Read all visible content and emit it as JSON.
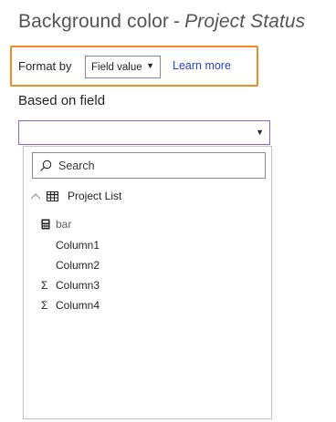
{
  "header": {
    "title_prefix": "Background color",
    "separator": "-",
    "title_field": "Project Status"
  },
  "format": {
    "label": "Format by",
    "selected": "Field value",
    "learn_more": "Learn more"
  },
  "based_on": {
    "label": "Based on field",
    "value": ""
  },
  "dropdown": {
    "search_placeholder": "Search",
    "table": {
      "name": "Project List",
      "expanded": true,
      "fields": [
        {
          "label": "bar",
          "icon": "calculator-icon",
          "kind": "measure"
        },
        {
          "label": "Column1",
          "icon": "",
          "kind": "text"
        },
        {
          "label": "Column2",
          "icon": "",
          "kind": "text"
        },
        {
          "label": "Column3",
          "icon": "sigma-icon",
          "kind": "numeric"
        },
        {
          "label": "Column4",
          "icon": "sigma-icon",
          "kind": "numeric"
        }
      ]
    }
  },
  "colors": {
    "highlight_border": "#f08a24",
    "focus_border": "#8c63c9",
    "link": "#2b3ec4"
  }
}
